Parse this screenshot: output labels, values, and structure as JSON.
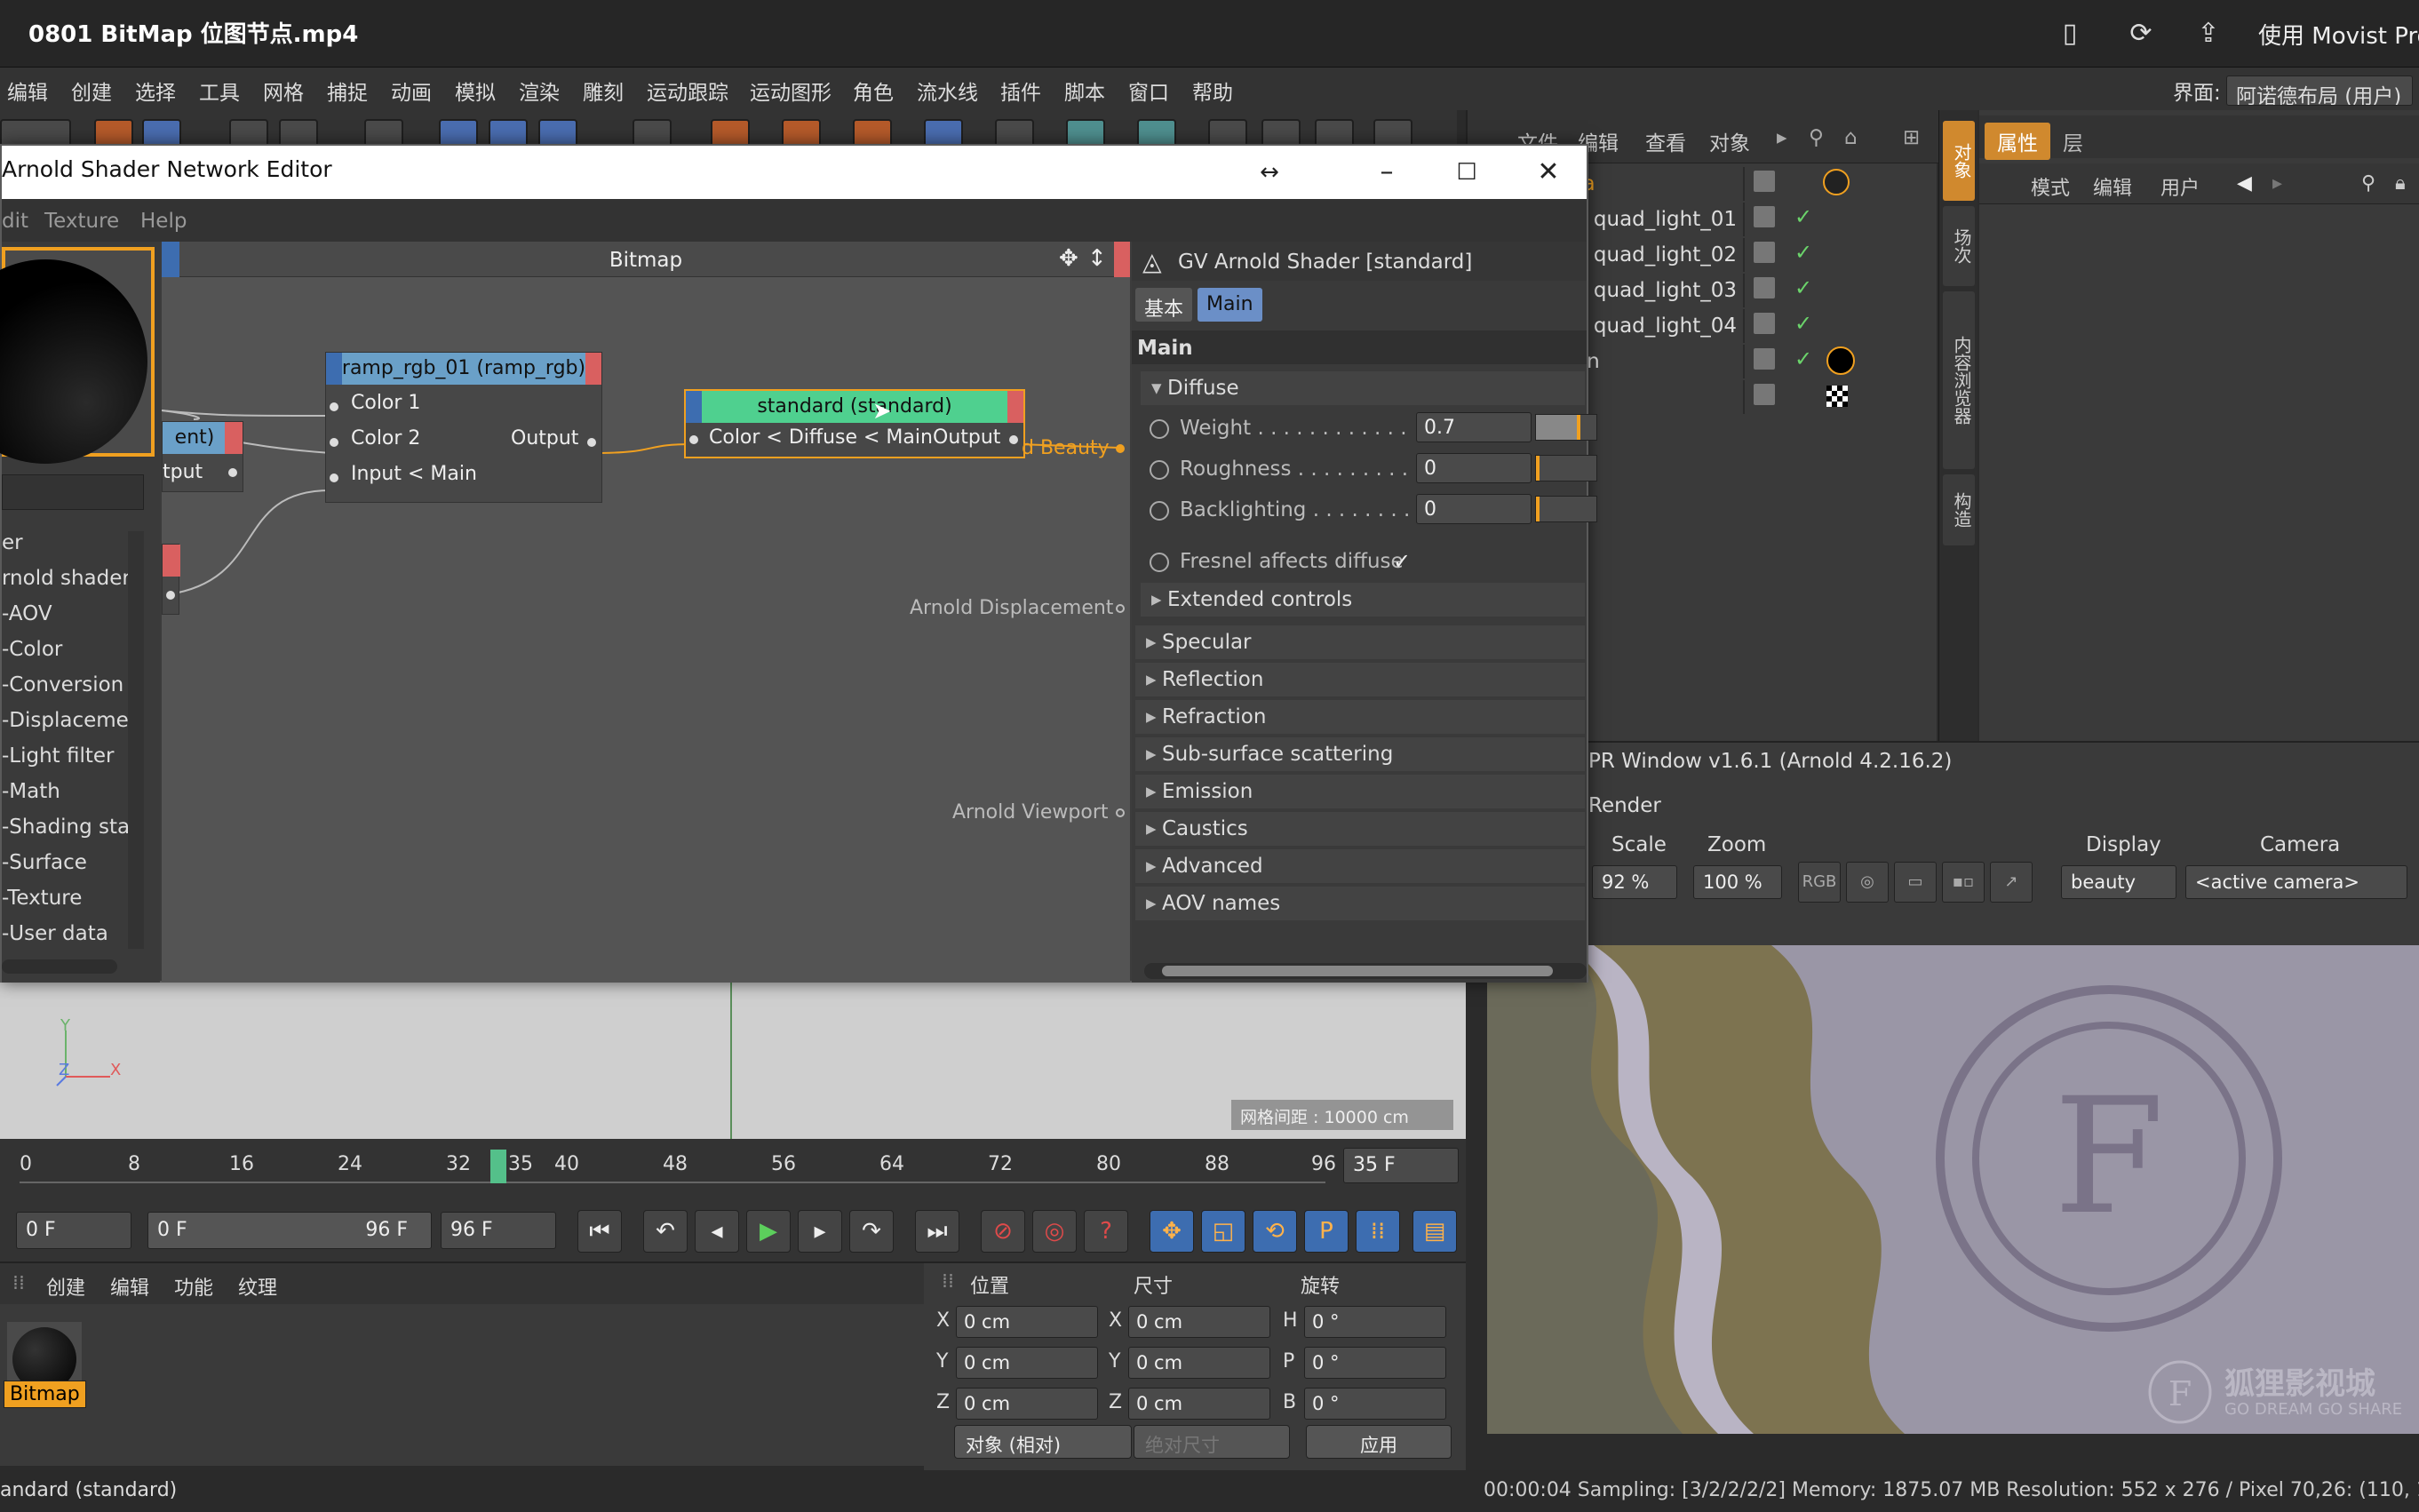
{
  "window": {
    "title": "0801 BitMap 位图节点.mp4",
    "movist": "使用 Movist Pro"
  },
  "menubar": {
    "items": [
      "编辑",
      "创建",
      "选择",
      "工具",
      "网格",
      "捕捉",
      "动画",
      "模拟",
      "渲染",
      "雕刻",
      "运动跟踪",
      "运动图形",
      "角色",
      "流水线",
      "插件",
      "脚本",
      "窗口",
      "帮助"
    ],
    "layout_label": "界面:",
    "layout_value": "阿诺德布局 (用户)"
  },
  "object_manager": {
    "menu": [
      "文件",
      "编辑",
      "查看",
      "对象"
    ],
    "rows": [
      "ra",
      "d quad_light_01",
      "d quad_light_02",
      "d quad_light_03",
      "d quad_light_04",
      "on",
      ""
    ]
  },
  "side_tabs": [
    "对象",
    "场次",
    "内容浏览器",
    "构造"
  ],
  "attributes": {
    "tabs": [
      "属性",
      "层"
    ],
    "submenu": [
      "模式",
      "编辑",
      "用户"
    ]
  },
  "ipr": {
    "title": "PR Window v1.6.1 (Arnold 4.2.16.2)",
    "render_label": "Render",
    "scale_label": "Scale",
    "scale_value": "92 %",
    "zoom_label": "Zoom",
    "zoom_value": "100 %",
    "rgb": "RGB",
    "display_label": "Display",
    "display_value": "beauty",
    "camera_label": "Camera",
    "camera_value": "<active camera>",
    "watermark": "狐狸影视城",
    "watermark_sub": "GO DREAM GO SHARE"
  },
  "ipr_status": "00:00:04  Sampling: [3/2/2/2/2]  Memory: 1875.07 MB  Resolution: 552 x 276 / Pixel 70,26: (110, 189,",
  "viewport": {
    "distance": "网格间距 : 10000 cm",
    "axis_y": "Y",
    "axis_x": "X",
    "axis_z": "Z"
  },
  "timeline": {
    "ticks": [
      "0",
      "8",
      "16",
      "24",
      "32",
      "35",
      "40",
      "48",
      "56",
      "64",
      "72",
      "80",
      "88",
      "96"
    ],
    "current_frame": 35,
    "frame_field": "35 F"
  },
  "transport": {
    "start": "0 F",
    "range_start": "0 F",
    "range_end": "96 F",
    "end": "96 F"
  },
  "material_manager": {
    "menu": [
      "创建",
      "编辑",
      "功能",
      "纹理"
    ],
    "material_name": "Bitmap"
  },
  "coords": {
    "headers": [
      "位置",
      "尺寸",
      "旋转"
    ],
    "pos": [
      {
        "axis": "X",
        "value": "0 cm"
      },
      {
        "axis": "Y",
        "value": "0 cm"
      },
      {
        "axis": "Z",
        "value": "0 cm"
      }
    ],
    "size": [
      {
        "axis": "X",
        "value": "0 cm"
      },
      {
        "axis": "Y",
        "value": "0 cm"
      },
      {
        "axis": "Z",
        "value": "0 cm"
      }
    ],
    "rot": [
      {
        "axis": "H",
        "value": "0 °"
      },
      {
        "axis": "P",
        "value": "0 °"
      },
      {
        "axis": "B",
        "value": "0 °"
      }
    ],
    "mode": "对象 (相对)",
    "size_mode": "绝对尺寸",
    "apply": "应用"
  },
  "app_status": "andard (standard)",
  "editor": {
    "title": "Arnold Shader Network Editor",
    "menu": [
      "dit",
      "Texture",
      "Help"
    ],
    "canvas_title": "Bitmap",
    "tree": [
      "er",
      "rnold shader",
      "-AOV",
      "-Color",
      "-Conversion",
      "-Displaceme",
      "-Light filter",
      "-Math",
      "-Shading sta",
      "-Surface",
      "-Texture",
      "-User data"
    ],
    "nodes": {
      "partial": {
        "title": "ent)",
        "output": "tput"
      },
      "ramp": {
        "title": "ramp_rgb_01 (ramp_rgb)",
        "color1": "Color 1",
        "color2": "Color 2",
        "input": "Input < Main",
        "output": "Output"
      },
      "standard": {
        "title": "standard (standard)",
        "input": "Color < Diffuse < Main",
        "output": "Output"
      }
    },
    "outputs": {
      "beauty": "d Beauty",
      "displacement": "Arnold Displacement",
      "viewport": "Arnold Viewport"
    },
    "props": {
      "header": "GV Arnold Shader [standard]",
      "tabs": [
        "基本",
        "Main"
      ],
      "section": "Main",
      "diffuse": "Diffuse",
      "params": [
        {
          "label": "Weight . . . . . . . . . . . .",
          "value": "0.7",
          "level": 0.7
        },
        {
          "label": "Roughness . . . . . . . . .",
          "value": "0",
          "level": 0
        },
        {
          "label": "Backlighting . . . . . . . .",
          "value": "0",
          "level": 0
        }
      ],
      "fresnel": "Fresnel affects diffuse",
      "extended": "Extended controls",
      "groups": [
        "Specular",
        "Reflection",
        "Refraction",
        "Sub-surface scattering",
        "Emission",
        "Caustics",
        "Advanced",
        "AOV names"
      ]
    }
  }
}
